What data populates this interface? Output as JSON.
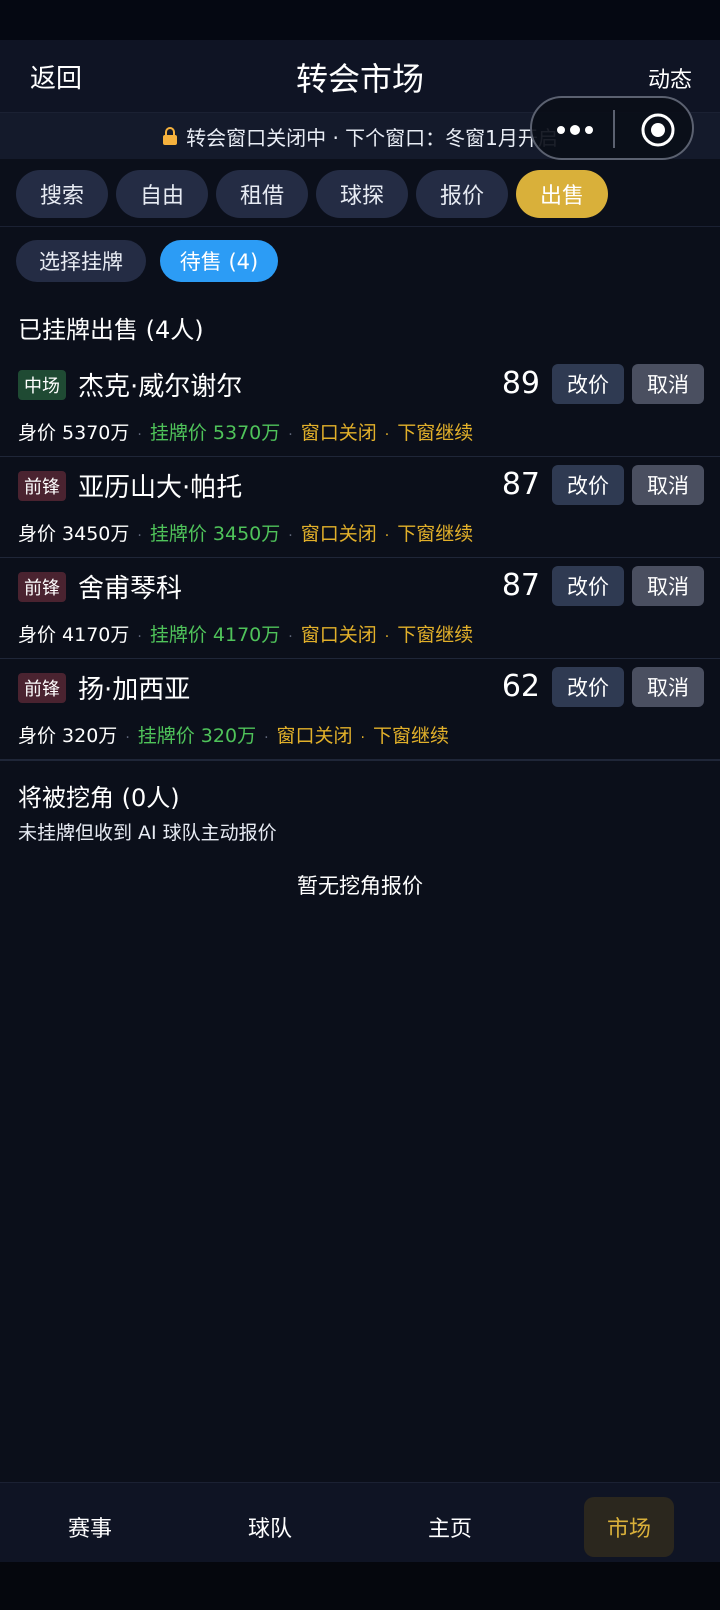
{
  "header": {
    "back_label": "返回",
    "title": "转会市场",
    "feed_label": "动态"
  },
  "notice": {
    "text": "转会窗口关闭中 · 下个窗口：冬窗1月开启",
    "icon": "lock-icon",
    "icon_color": "#f5b13d"
  },
  "tabs": [
    {
      "label": "搜索"
    },
    {
      "label": "自由"
    },
    {
      "label": "租借"
    },
    {
      "label": "球探"
    },
    {
      "label": "报价"
    },
    {
      "label": "出售",
      "active": true
    }
  ],
  "subtabs": [
    {
      "label": "选择挂牌"
    },
    {
      "label": "待售 (4)",
      "active": true
    }
  ],
  "listed": {
    "title": "已挂牌出售 (4人)",
    "players": [
      {
        "position": "中场",
        "name": "杰克·威尔谢尔",
        "rating": "89",
        "value": "身价 5370万",
        "listing": "挂牌价 5370万",
        "status1": "窗口关闭",
        "status2": "下窗继续",
        "edit": "改价",
        "cancel": "取消"
      },
      {
        "position": "前锋",
        "name": "亚历山大·帕托",
        "rating": "87",
        "value": "身价 3450万",
        "listing": "挂牌价 3450万",
        "status1": "窗口关闭",
        "status2": "下窗继续",
        "edit": "改价",
        "cancel": "取消"
      },
      {
        "position": "前锋",
        "name": "舍甫琴科",
        "rating": "87",
        "value": "身价 4170万",
        "listing": "挂牌价 4170万",
        "status1": "窗口关闭",
        "status2": "下窗继续",
        "edit": "改价",
        "cancel": "取消"
      },
      {
        "position": "前锋",
        "name": "扬·加西亚",
        "rating": "62",
        "value": "身价 320万",
        "listing": "挂牌价 320万",
        "status1": "窗口关闭",
        "status2": "下窗继续",
        "edit": "改价",
        "cancel": "取消"
      }
    ]
  },
  "poached": {
    "title": "将被挖角 (0人)",
    "subtitle": "未挂牌但收到 AI 球队主动报价",
    "empty": "暂无挖角报价"
  },
  "bottom_nav": [
    {
      "label": "赛事"
    },
    {
      "label": "球队"
    },
    {
      "label": "主页"
    },
    {
      "label": "市场",
      "active": true
    }
  ],
  "colors": {
    "accent_gold": "#d9b03a",
    "accent_blue": "#2c9cf5",
    "price_green": "#4fc35a",
    "status_yellow": "#e2b02a"
  }
}
